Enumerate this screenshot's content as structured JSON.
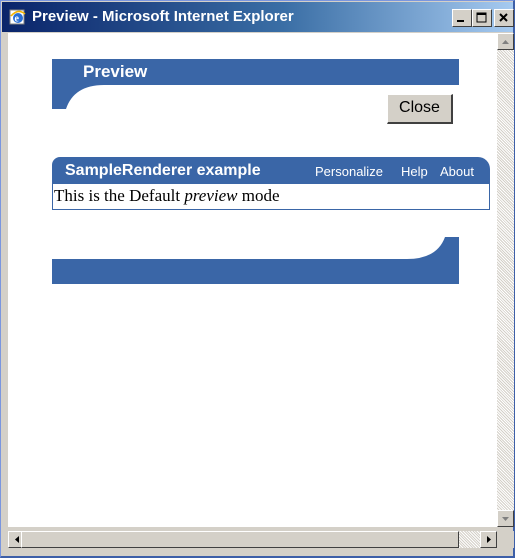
{
  "window": {
    "title": "Preview - Microsoft Internet Explorer",
    "icon": "ie-icon",
    "buttons": [
      "minimize-icon",
      "maximize-icon",
      "close-icon"
    ]
  },
  "page": {
    "header_title": "Preview",
    "close_label": "Close",
    "portlet": {
      "title": "SampleRenderer example",
      "links": [
        "Personalize",
        "Help",
        "About"
      ],
      "body_prefix": "This is the Default",
      "body_emphasis": "preview",
      "body_suffix": "mode"
    }
  },
  "colors": {
    "theme_blue": "#3a66a7",
    "title_gradient_start": "#0a246a",
    "title_gradient_end": "#a6caf0"
  }
}
